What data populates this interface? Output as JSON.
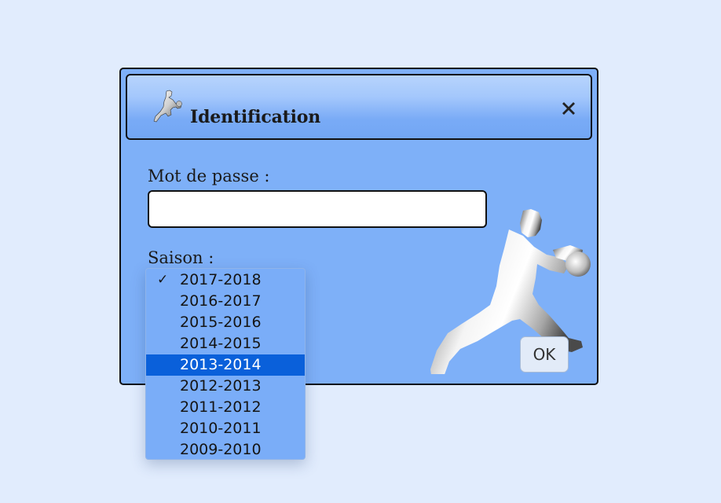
{
  "dialog": {
    "title": "Identification",
    "close_icon": "close-x-icon",
    "title_icon": "basketball-player-icon",
    "background_color": "#7eb0f8"
  },
  "form": {
    "password_label": "Mot de passe :",
    "password_value": "",
    "season_label": "Saison :",
    "ok_label": "OK"
  },
  "season_dropdown": {
    "selected": "2017-2018",
    "highlighted": "2013-2014",
    "check_mark": "✓",
    "highlight_color": "#0a60da",
    "options": [
      {
        "label": "2017-2018"
      },
      {
        "label": "2016-2017"
      },
      {
        "label": "2015-2016"
      },
      {
        "label": "2014-2015"
      },
      {
        "label": "2013-2014"
      },
      {
        "label": "2012-2013"
      },
      {
        "label": "2011-2012"
      },
      {
        "label": "2010-2011"
      },
      {
        "label": "2009-2010"
      }
    ]
  },
  "decor": {
    "illustration": "basketball-player-silhouette"
  }
}
